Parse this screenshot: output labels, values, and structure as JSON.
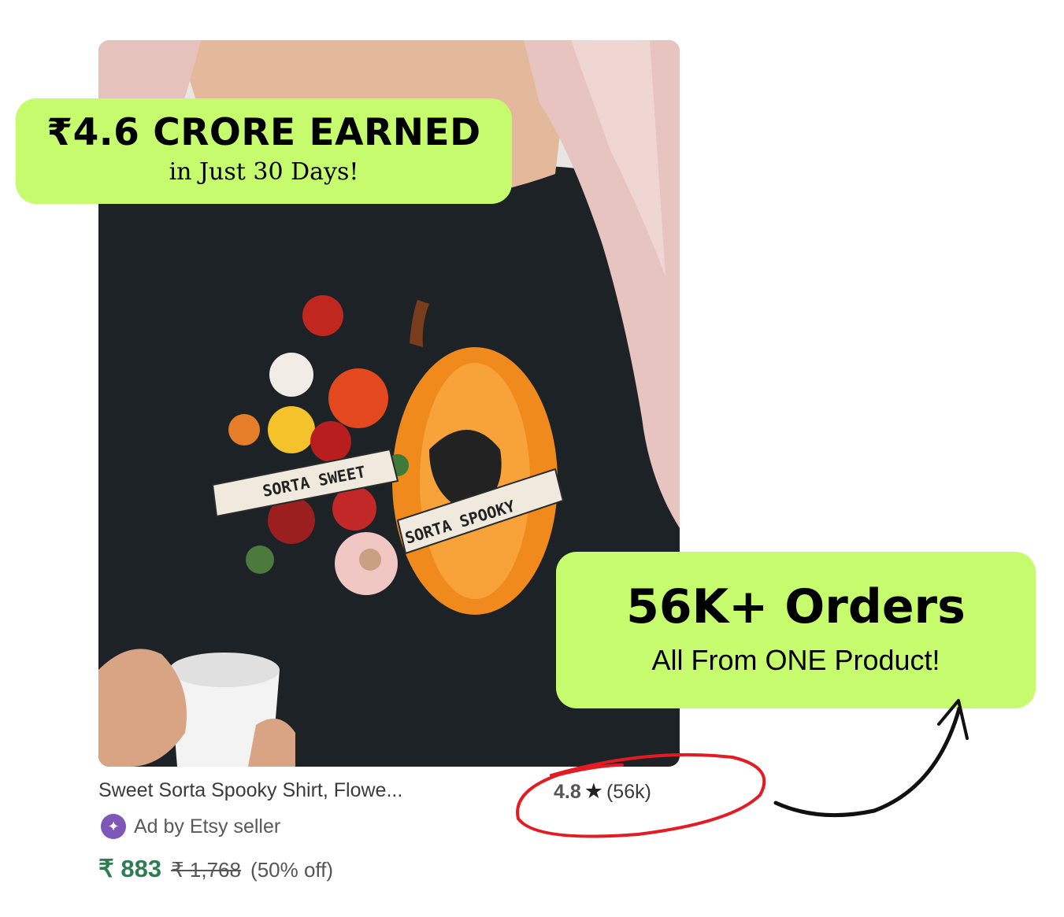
{
  "promo_top": {
    "headline": "₹4.6 CRORE EARNED",
    "subline": "in Just 30 Days!"
  },
  "promo_bottom": {
    "headline": "56K+ Orders",
    "subline": "All From ONE Product!"
  },
  "listing": {
    "image_text_1": "SORTA SWEET",
    "image_text_2": "SORTA SPOOKY",
    "title": "Sweet Sorta Spooky Shirt, Flowe...",
    "rating": "4.8",
    "star": "★",
    "reviews": "(56k)",
    "seller_label": "Ad by Etsy seller",
    "seller_icon": "star-badge-icon",
    "price_now": "₹ 883",
    "price_was": "₹ 1,768",
    "discount": "(50% off)"
  },
  "colors": {
    "badge": "#c5fb6c",
    "highlight_circle": "#e31b23",
    "price": "#2e7d52",
    "seller_icon": "#7d58b8"
  }
}
